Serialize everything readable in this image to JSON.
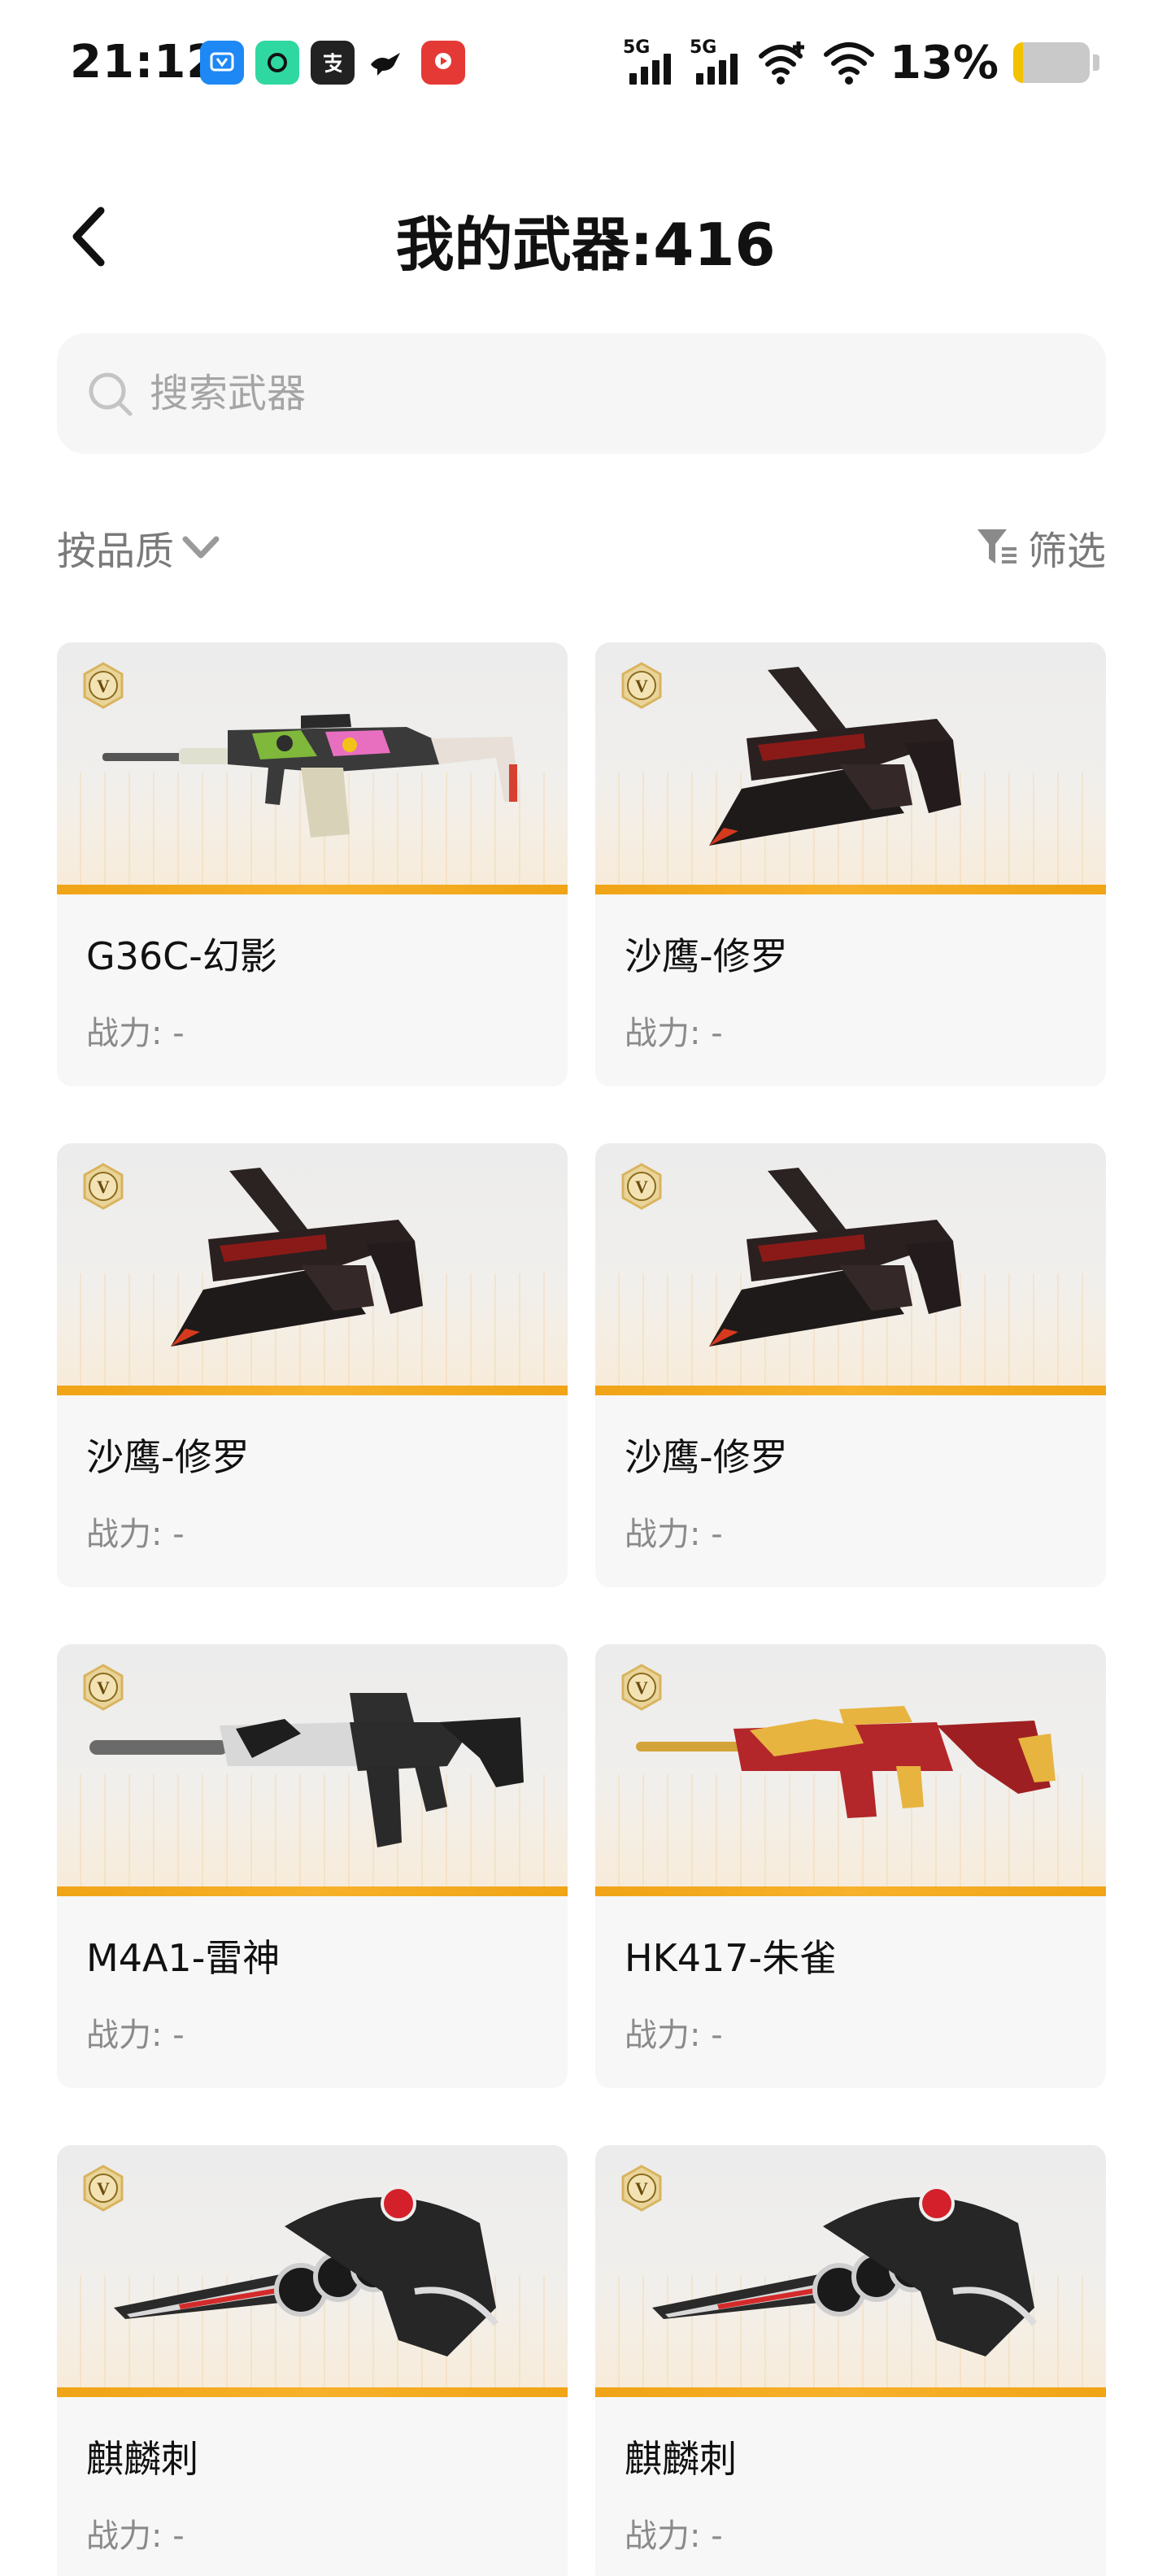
{
  "status_bar": {
    "time": "21:12",
    "network_1": "5G",
    "network_2": "5G",
    "battery_percent": "13%",
    "battery_level": 0.13,
    "app_icons": [
      "vip-app-icon",
      "camera-app-icon",
      "alipay-icon",
      "bird-app-icon",
      "video-app-icon"
    ]
  },
  "header": {
    "title": "我的武器:416"
  },
  "search": {
    "placeholder": "搜索武器"
  },
  "sort_bar": {
    "sort_label": "按品质",
    "filter_label": "筛选"
  },
  "weapons": [
    {
      "name": "G36C-幻影",
      "power": "战力: -",
      "art": "rifle-camo"
    },
    {
      "name": "沙鹰-修罗",
      "power": "战力: -",
      "art": "pistol-blade"
    },
    {
      "name": "沙鹰-修罗",
      "power": "战力: -",
      "art": "pistol-blade"
    },
    {
      "name": "沙鹰-修罗",
      "power": "战力: -",
      "art": "pistol-blade"
    },
    {
      "name": "M4A1-雷神",
      "power": "战力: -",
      "art": "rifle-silver"
    },
    {
      "name": "HK417-朱雀",
      "power": "战力: -",
      "art": "rifle-gold"
    },
    {
      "name": "麒麟刺",
      "power": "战力: -",
      "art": "knuckle-blade"
    },
    {
      "name": "麒麟刺",
      "power": "战力: -",
      "art": "knuckle-blade"
    }
  ],
  "colors": {
    "accent_orange": "#f0a416",
    "text_primary": "#111111",
    "text_secondary": "#8a8a8a",
    "card_bg": "#f7f7f7"
  }
}
